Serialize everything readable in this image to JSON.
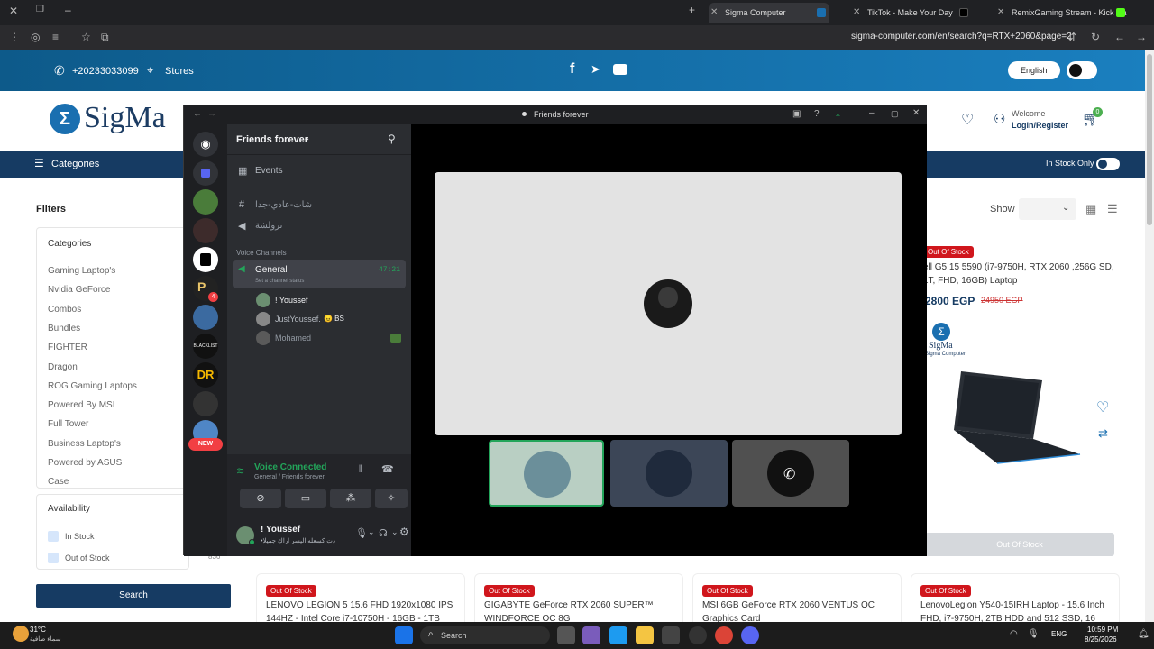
{
  "browser": {
    "tabs": [
      {
        "title": "Sigma Computer",
        "fav_color": "#1a6fb0"
      },
      {
        "title": "TikTok - Make Your Day",
        "fav_color": "#111111"
      },
      {
        "title": "RemixGaming Stream - Kick Da",
        "fav_color": "#53fc18"
      }
    ],
    "url": "sigma-computer.com/en/search?q=RTX+2060&page=2"
  },
  "site": {
    "phone": "+20233033099",
    "stores": "Stores",
    "language": "English",
    "logo_text": "SigMa",
    "welcome": "Welcome",
    "login": "Login/Register",
    "cart_count": "0",
    "categories_label": "Categories",
    "in_stock_only": "In Stock Only",
    "show_label": "Show",
    "filters_title": "Filters",
    "categories_title": "Categories",
    "category_items": [
      "Gaming Laptop's",
      "Nvidia GeForce",
      "Combos",
      "Bundles",
      "FIGHTER",
      "Dragon",
      "ROG Gaming Laptops",
      "Powered By MSI",
      "Full Tower",
      "Business Laptop's",
      "Powered by ASUS",
      "Case"
    ],
    "availability_title": "Availability",
    "availability_items": [
      "In Stock",
      "Out of Stock"
    ],
    "count_hint": "836",
    "search_button": "Search",
    "product": {
      "badge": "Out Of Stock",
      "name": "ell G5 15 5590 (i7-9750H, RTX 2060 ,256G SD, 1T, FHD, 16GB) Laptop",
      "price": "2800 EGP",
      "old_price": "24950 EGP",
      "card_logo": "SigMa",
      "card_logo_sub": "Sigma Computer",
      "button": "Out Of Stock"
    },
    "bottom_products": [
      {
        "badge": "Out Of Stock",
        "name": "LENOVO LEGION 5 15.6 FHD 1920x1080 IPS 144HZ - Intel Core i7-10750H - 16GB - 1TB"
      },
      {
        "badge": "Out Of Stock",
        "name": "GIGABYTE GeForce RTX 2060 SUPER™ WINDFORCE OC 8G"
      },
      {
        "badge": "Out Of Stock",
        "name": "MSI 6GB GeForce RTX 2060 VENTUS OC Graphics Card"
      },
      {
        "badge": "Out Of Stock",
        "name": "LenovoLegion Y540-15IRH Laptop - 15.6 Inch FHD, i7-9750H, 2TB HDD and 512 SSD, 16"
      }
    ]
  },
  "discord": {
    "window_title": "Friends forever",
    "server_name": "Friends forever",
    "events": "Events",
    "text_channels": [
      "شات-عادي-جدا",
      "ترولشة"
    ],
    "voice_section": "Voice Channels",
    "voice_channel": "General",
    "voice_timer": "47:21",
    "status_placeholder": "Set a channel status",
    "members": [
      {
        "name": "! Youssef",
        "tag": ""
      },
      {
        "name": "JustYoussef.",
        "tag": "😠 BS"
      },
      {
        "name": "Mohamed",
        "tag": ""
      }
    ],
    "new_badge": "NEW",
    "notif_count": "4",
    "voice_connected": "Voice Connected",
    "voice_sub": "General / Friends forever",
    "user_name": "! Youssef",
    "user_status": "•دت كسعله اليسر اراك جميلا"
  },
  "taskbar": {
    "weather_temp": "31°C",
    "weather_desc": "سماء صافية",
    "search": "Search",
    "lang": "ENG",
    "time": "10:59 PM",
    "date": "8/25/2026"
  },
  "colors": {
    "site_blue": "#163b63",
    "badge_red": "#d0161c",
    "discord_green": "#23a55a"
  }
}
